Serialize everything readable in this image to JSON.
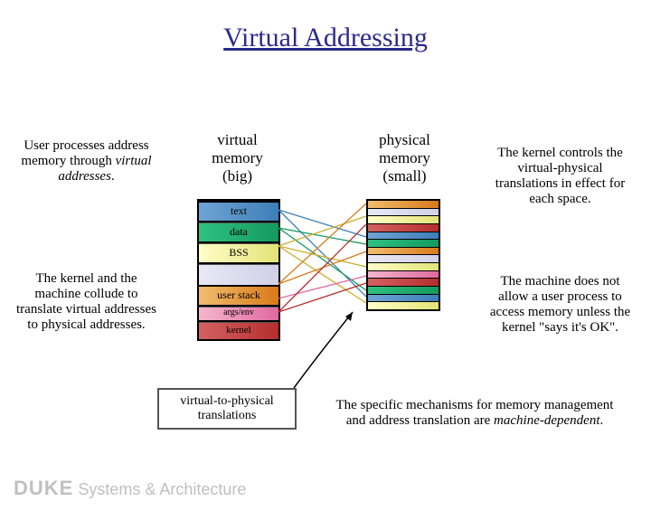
{
  "title": "Virtual Addressing",
  "left1": "User processes address memory through virtual addresses.",
  "left2": "The kernel and the machine collude to translate virtual addresses to physical addresses.",
  "right1": "The kernel controls the virtual-physical translations in effect for each space.",
  "right2": "The machine does not allow a user process to access memory unless the kernel \"says it's OK\".",
  "vm_label": "virtual\nmemory\n(big)",
  "phys_label": "physical\nmemory\n(small)",
  "seg_text": "text",
  "seg_data": "data",
  "seg_bss": "BSS",
  "seg_stack": "user stack",
  "seg_args": "args/env",
  "seg_kernel": "kernel",
  "trans_label": "virtual-to-physical translations",
  "bottom": "The specific mechanisms for memory management and address translation are machine-dependent.",
  "footer_brand": "DUKE",
  "footer_sub": " Systems & Architecture"
}
